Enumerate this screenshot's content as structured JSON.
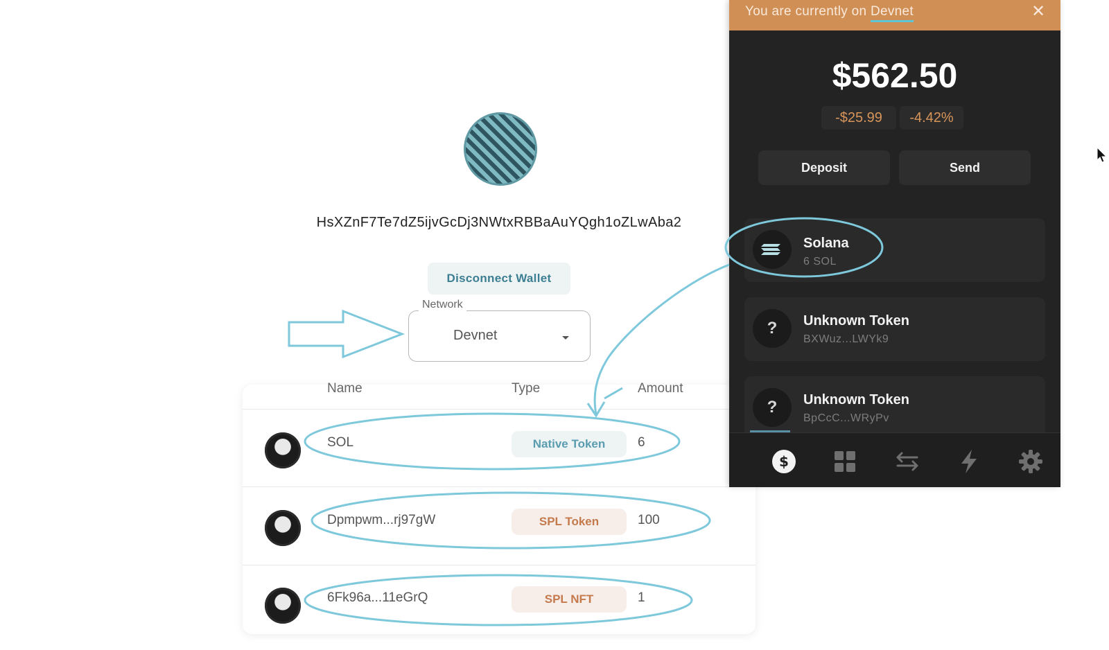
{
  "dapp": {
    "address": "HsXZnF7Te7dZ5ijvGcDj3NWtxRBBaAuYQgh1oZLwAba2",
    "disconnect_label": "Disconnect Wallet",
    "network": {
      "label": "Network",
      "value": "Devnet"
    },
    "table": {
      "headers": {
        "name": "Name",
        "type": "Type",
        "amount": "Amount"
      },
      "rows": [
        {
          "name": "SOL",
          "type": "Native Token",
          "amount": "6"
        },
        {
          "name": "Dpmpwm...rj97gW",
          "type": "SPL Token",
          "amount": "100"
        },
        {
          "name": "6Fk96a...11eGrQ",
          "type": "SPL NFT",
          "amount": "1"
        }
      ]
    }
  },
  "wallet": {
    "banner": {
      "prefix": "You are currently on",
      "network": "Devnet",
      "close": "✕"
    },
    "balance": "$562.50",
    "change_usd": "-$25.99",
    "change_pct": "-4.42%",
    "deposit_label": "Deposit",
    "send_label": "Send",
    "tokens": [
      {
        "name": "Solana",
        "sub": "6 SOL",
        "icon": "solana-logo-icon"
      },
      {
        "name": "Unknown Token",
        "sub": "BXWuz...LWYk9",
        "icon": "question-mark-icon"
      },
      {
        "name": "Unknown Token",
        "sub": "BpCcC...WRyPv",
        "icon": "question-mark-icon"
      }
    ],
    "tabs": [
      "dollar-icon",
      "grid-icon",
      "swap-arrows-icon",
      "lightning-icon",
      "gear-icon"
    ]
  },
  "colors": {
    "accent_teal": "#3d7f92",
    "banner_orange": "#cf8f55",
    "annotation_blue": "#7ec8dc",
    "wallet_bg": "#232323",
    "change_orange": "#d8955a"
  }
}
